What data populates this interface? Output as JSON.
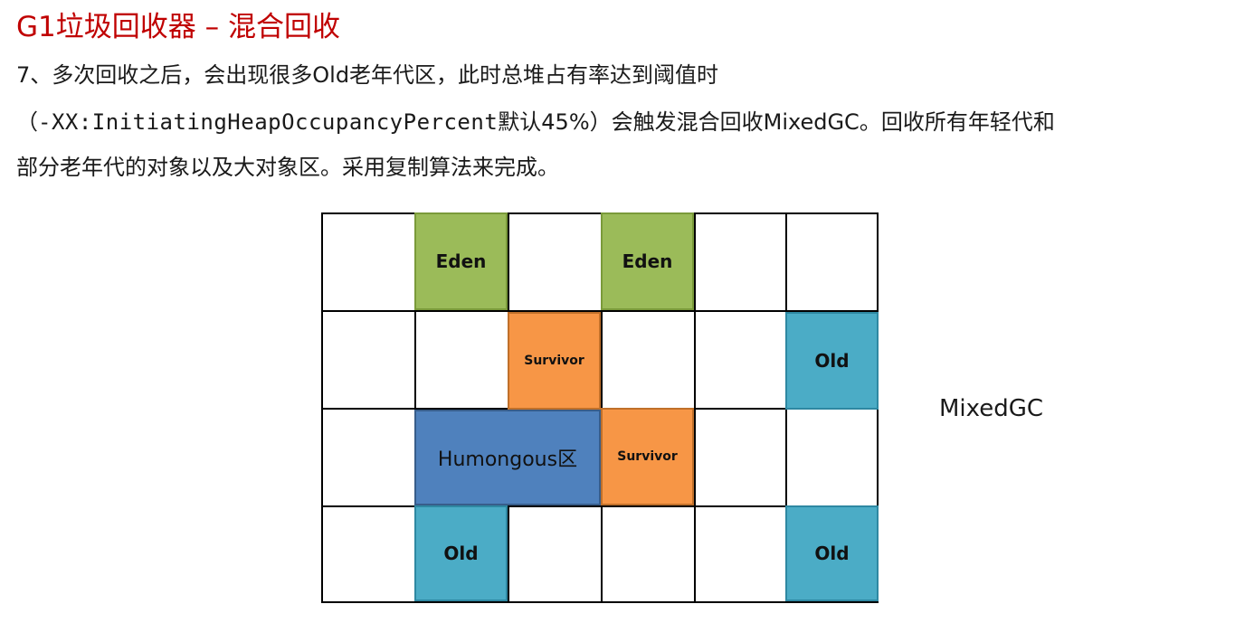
{
  "title": "G1垃圾回收器 – 混合回收",
  "paragraph": {
    "line1": "7、多次回收之后，会出现很多Old老年代区，此时总堆占有率达到阈值时",
    "line2_open": "（",
    "line2_code": "-XX:InitiatingHeapOccupancyPercent",
    "line2_rest": "默认45%）会触发混合回收MixedGC。回收所有年轻代和",
    "line3": "部分老年代的对象以及大对象区。采用复制算法来完成。"
  },
  "diagram": {
    "side_label": "MixedGC",
    "regions": {
      "eden_1": "Eden",
      "eden_2": "Eden",
      "survivor_1": "Survivor",
      "survivor_2": "Survivor",
      "old_1": "Old",
      "old_2": "Old",
      "old_3": "Old",
      "humongous": "Humongous区"
    },
    "colors": {
      "eden": "#9bbb59",
      "survivor": "#f79646",
      "old": "#4bacc6",
      "humongous": "#4f81bd",
      "title": "#c00000"
    }
  }
}
